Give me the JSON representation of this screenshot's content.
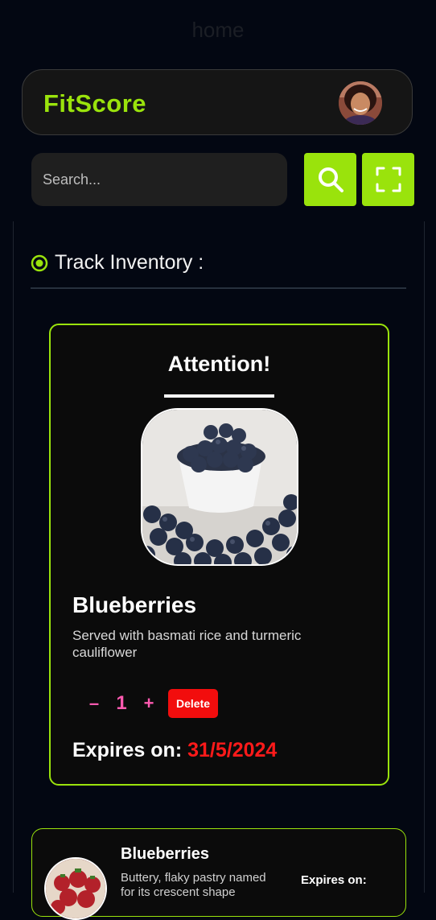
{
  "page": {
    "title": "home"
  },
  "header": {
    "brand": "FitScore"
  },
  "search": {
    "placeholder": "Search..."
  },
  "section": {
    "title": "Track Inventory :"
  },
  "alert_card": {
    "title": "Attention!",
    "name": "Blueberries",
    "description": "Served with basmati rice and turmeric cauliflower",
    "quantity": "1",
    "minus_label": "–",
    "plus_label": "+",
    "delete_label": "Delete",
    "expires_label": "Expires on:",
    "expires_date": "31/5/2024"
  },
  "items": [
    {
      "name": "Blueberries",
      "description": "Buttery, flaky pastry named for its crescent shape",
      "expires_label": "Expires on:"
    }
  ],
  "colors": {
    "accent": "#9ae30c",
    "background": "#030712",
    "danger": "#f20d0d",
    "quantity": "#ff5ab0"
  },
  "icons": {
    "search_button": "search-icon",
    "scan_button": "scan-frame-icon",
    "section_marker": "radio-target-icon"
  }
}
